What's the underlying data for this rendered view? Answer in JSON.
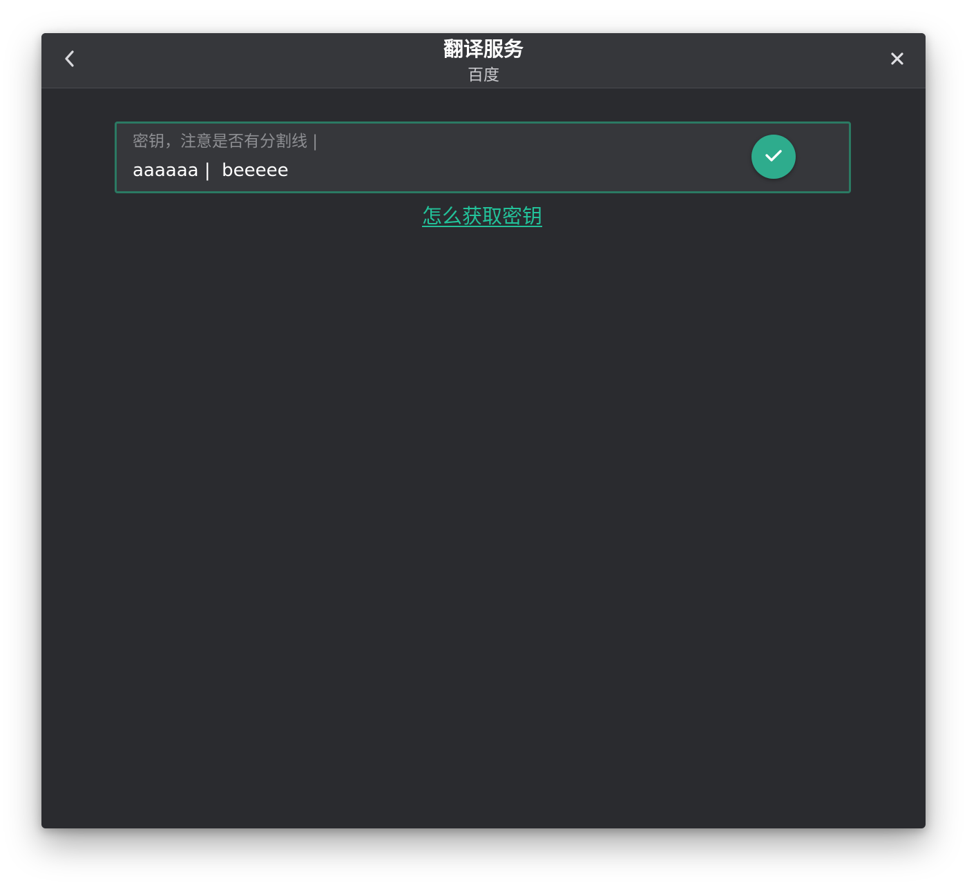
{
  "titlebar": {
    "title": "翻译服务",
    "subtitle": "百度",
    "back_icon": "chevron-left-icon",
    "close_icon": "close-icon"
  },
  "key_field": {
    "label": "密钥，注意是否有分割线 |",
    "value": "aaaaaa |  beeeee",
    "confirm_icon": "check-icon"
  },
  "help_link": {
    "label": "怎么获取密钥"
  },
  "colors": {
    "window_bg": "#2a2b2f",
    "titlebar_bg": "#36373b",
    "accent": "#2eac8d",
    "field_border": "#2b7a63",
    "link": "#23c29a"
  }
}
